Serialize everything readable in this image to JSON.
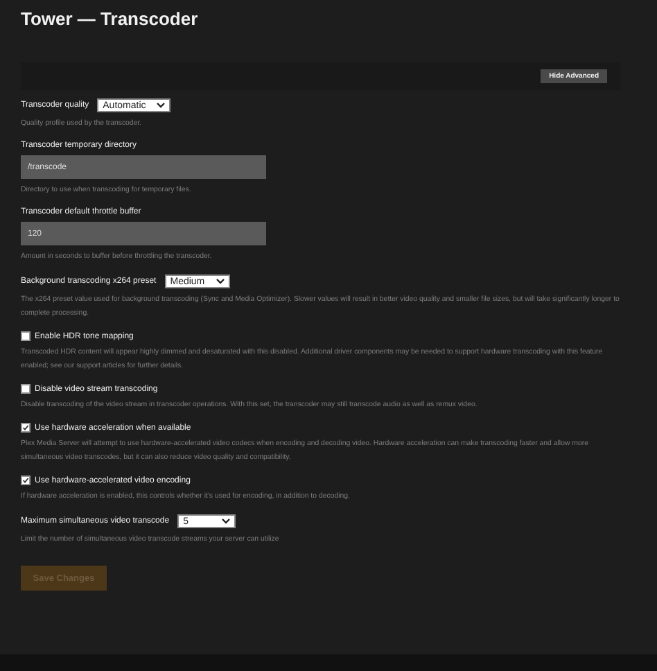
{
  "title": "Tower — Transcoder",
  "advanced_button": {
    "label": "Hide Advanced"
  },
  "settings": [
    {
      "kind": "select",
      "label": "Transcoder quality",
      "value": "Automatic",
      "hint": "Quality profile used by the transcoder."
    },
    {
      "kind": "text",
      "label": "Transcoder temporary directory",
      "value": "/transcode",
      "hint": "Directory to use when transcoding for temporary files."
    },
    {
      "kind": "text",
      "label": "Transcoder default throttle buffer",
      "value": "120",
      "hint": "Amount in seconds to buffer before throttling the transcoder."
    },
    {
      "kind": "select",
      "label": "Background transcoding x264 preset",
      "value": "Medium",
      "hint": "The x264 preset value used for background transcoding (Sync and Media Optimizer). Slower values will result in better video quality and smaller file sizes, but will take significantly longer to complete processing."
    },
    {
      "kind": "checkbox",
      "label": "Enable HDR tone mapping",
      "checked": false,
      "hint": "Transcoded HDR content will appear highly dimmed and desaturated with this disabled. Additional driver components may be needed to support hardware transcoding with this feature enabled; see our support articles for further details."
    },
    {
      "kind": "checkbox",
      "label": "Disable video stream transcoding",
      "checked": false,
      "hint": "Disable transcoding of the video stream in transcoder operations. With this set, the transcoder may still transcode audio as well as remux video."
    },
    {
      "kind": "checkbox",
      "label": "Use hardware acceleration when available",
      "checked": true,
      "hint": "Plex Media Server will attempt to use hardware-accelerated video codecs when encoding and decoding video. Hardware acceleration can make transcoding faster and allow more simultaneous video transcodes, but it can also reduce video quality and compatibility."
    },
    {
      "kind": "checkbox",
      "label": "Use hardware-accelerated video encoding",
      "checked": true,
      "hint": "If hardware acceleration is enabled, this controls whether it's used for encoding, in addition to decoding."
    },
    {
      "kind": "select",
      "label": "Maximum simultaneous video transcode",
      "value": "5",
      "hint": "Limit the number of simultaneous video transcode streams your server can utilize"
    }
  ],
  "save_button": {
    "label": "Save Changes",
    "disabled": true
  }
}
